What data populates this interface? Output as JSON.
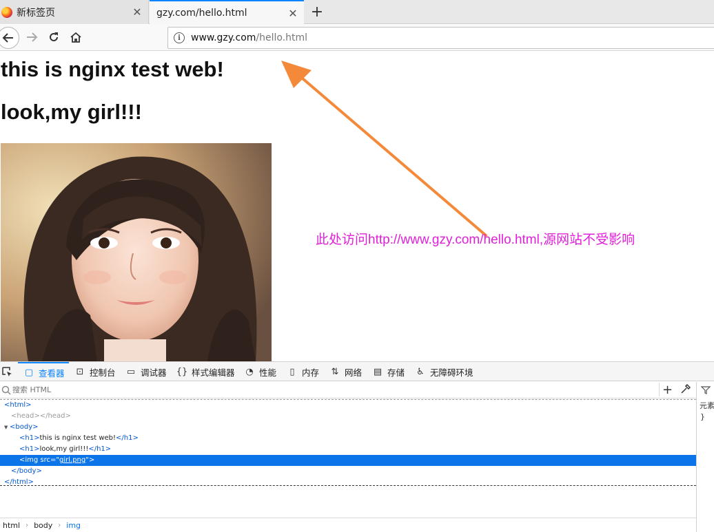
{
  "tabs": [
    {
      "label": "新标签页",
      "close": "✕"
    },
    {
      "label": "gzy.com/hello.html",
      "close": "✕"
    }
  ],
  "newtab_label": "+",
  "navbar": {
    "url_host": "www.gzy.com",
    "url_path": "/hello.html"
  },
  "page": {
    "heading1": "this is nginx test web!",
    "heading2": "look,my girl!!!",
    "annotation": "此处访问http://www.gzy.com/hello.html,源网站不受影响",
    "annotation_color": "#e020d8",
    "arrow_color": "#f5893a"
  },
  "devtools": {
    "tabs": [
      {
        "label": "查看器",
        "icon": "inspector-icon"
      },
      {
        "label": "控制台",
        "icon": "console-icon"
      },
      {
        "label": "调试器",
        "icon": "debugger-icon"
      },
      {
        "label": "样式编辑器",
        "icon": "style-editor-icon"
      },
      {
        "label": "性能",
        "icon": "performance-icon"
      },
      {
        "label": "内存",
        "icon": "memory-icon"
      },
      {
        "label": "网络",
        "icon": "network-icon"
      },
      {
        "label": "存储",
        "icon": "storage-icon"
      },
      {
        "label": "无障碍环境",
        "icon": "accessibility-icon"
      }
    ],
    "search_placeholder": "搜索 HTML",
    "markup": {
      "html_open": "<html>",
      "head": "<head></head>",
      "body_open": "<body>",
      "h1a_open": "<h1>",
      "h1a_text": "this is nginx test web!",
      "h1a_close": "</h1>",
      "h1b_open": "<h1>",
      "h1b_text": "look,my girl!!!",
      "h1b_close": "</h1>",
      "img_open": "<img src=\"",
      "img_src": "girl.png",
      "img_close": "\">",
      "body_close": "</body>",
      "html_close": "</html>"
    },
    "rules_element": "元素",
    "rules_brace": "}",
    "breadcrumbs": [
      "html",
      "body",
      "img"
    ],
    "accent_color": "#0a84ff"
  }
}
